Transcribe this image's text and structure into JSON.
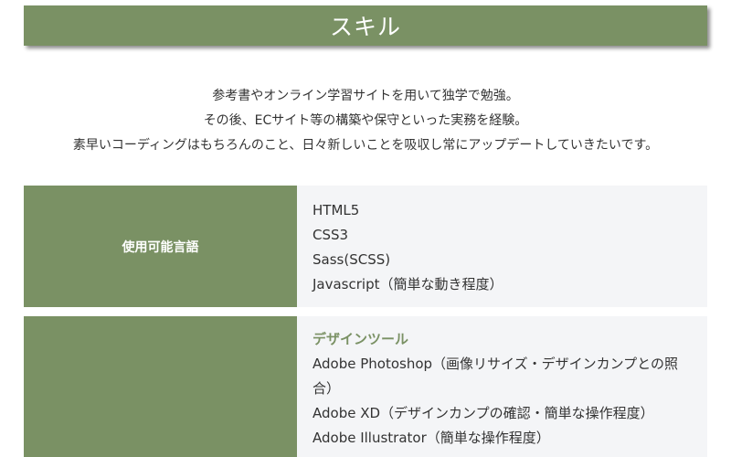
{
  "section": {
    "title": "スキル"
  },
  "intro": {
    "lines": [
      "参考書やオンライン学習サイトを用いて独学で勉強。",
      "その後、ECサイト等の構築や保守といった実務を経験。",
      "素早いコーディングはもちろんのこと、日々新しいことを吸収し常にアップデートしていきたいです。"
    ]
  },
  "skills": [
    {
      "label": "使用可能言語",
      "items": [
        "HTML5",
        "CSS3",
        "Sass(SCSS)",
        "Javascript（簡単な動き程度）"
      ]
    },
    {
      "label": "",
      "subheading": "デザインツール",
      "items": [
        "Adobe Photoshop（画像リサイズ・デザインカンプとの照合）",
        "Adobe XD（デザインカンプの確認・簡単な操作程度）",
        "Adobe Illustrator（簡単な操作程度）"
      ]
    }
  ],
  "colors": {
    "accent": "#7a9164",
    "content_bg": "#f4f5f7",
    "text": "#333333"
  }
}
